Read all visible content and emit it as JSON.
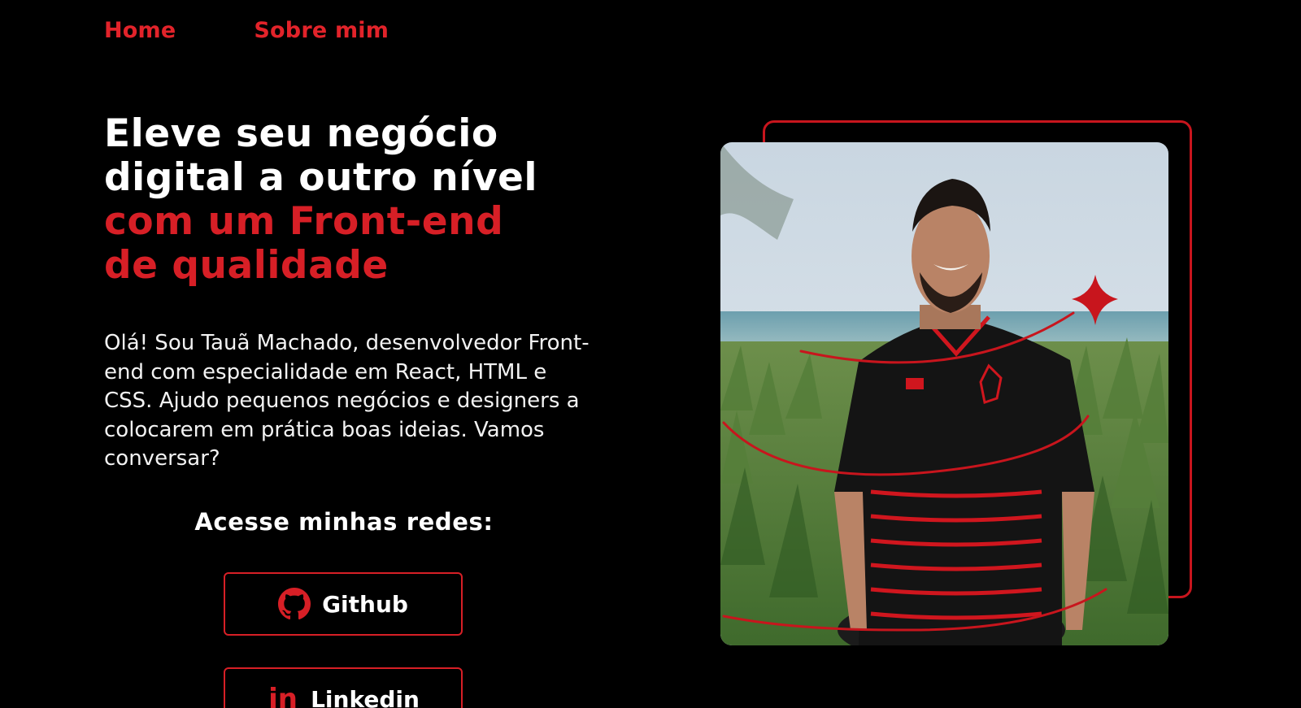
{
  "nav": {
    "items": [
      {
        "label": "Home"
      },
      {
        "label": "Sobre mim"
      }
    ]
  },
  "hero": {
    "headline_white": [
      "Eleve seu negócio",
      "digital a outro nível"
    ],
    "headline_red": [
      "com um Front-end",
      "de qualidade"
    ],
    "bio": "Olá! Sou Tauã Machado, desenvolvedor Front-end com especialidade em React, HTML e CSS. Ajudo pequenos negócios e designers a colocarem em prática boas ideias. Vamos conversar?"
  },
  "networks": {
    "title": "Acesse minhas redes:",
    "github_label": "Github",
    "linkedin_label": "Linkedin",
    "linkedin_icon_text": "in"
  },
  "icons": {
    "github": "github-icon",
    "linkedin": "linkedin-icon",
    "sparkle": "sparkle-icon"
  },
  "colors": {
    "background": "#000000",
    "accent_red": "#d71f26",
    "text_white": "#ffffff"
  }
}
